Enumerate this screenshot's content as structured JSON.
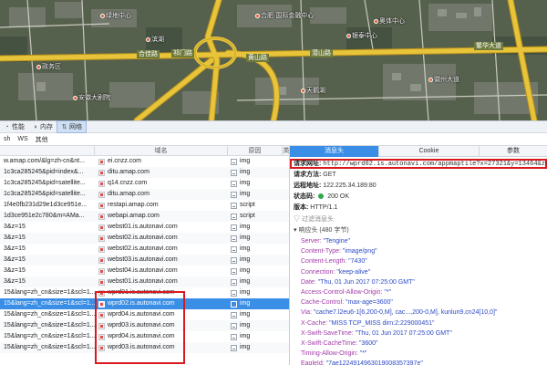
{
  "map": {
    "road_labels": [
      "合佳路",
      "祁门路",
      "黄山路",
      "潜山路",
      "繁华大道"
    ],
    "place_labels": [
      "绿地中心",
      "合肥·国际金融中心",
      "奥体中心",
      "政务区",
      "滨湖",
      "天鹅湖",
      "徽州大道",
      "安徽大剧院",
      "银泰中心"
    ],
    "colors": {
      "road": "#e7c43a",
      "road_edge": "#b8901c",
      "terrain": "#56614d",
      "water": "#3b4a55"
    }
  },
  "devtools": {
    "tabs": [
      {
        "icon": "gauge-icon",
        "label": "性能"
      },
      {
        "icon": "memory-icon",
        "label": "内存"
      },
      {
        "icon": "network-icon",
        "label": "网络"
      }
    ],
    "filters": [
      "sh",
      "WS",
      "其他"
    ]
  },
  "request_list": {
    "columns": [
      "",
      "域名",
      "原因",
      "类"
    ],
    "rows": [
      {
        "path": "w.amap.com/&lg=zh-cn&nt...",
        "domain": "ei.cnzz.com",
        "type": "img"
      },
      {
        "path": "1c3ca285245&pid=index&...",
        "domain": "ditu.amap.com",
        "type": "img"
      },
      {
        "path": "1c3ca285245&pid=satellite...",
        "domain": "q14.cnzz.com",
        "type": "img"
      },
      {
        "path": "1c3ca285245&pid=satellite...",
        "domain": "ditu.amap.com",
        "type": "img"
      },
      {
        "path": "1f4e0fb231d29e1d3ce951e...",
        "domain": "restapi.amap.com",
        "type": "script"
      },
      {
        "path": "1d3ce951e2c780&m=AMa...",
        "domain": "webapi.amap.com",
        "type": "script"
      },
      {
        "path": "3&z=15",
        "domain": "webst01.is.autonavi.com",
        "type": "img"
      },
      {
        "path": "3&z=15",
        "domain": "webst02.is.autonavi.com",
        "type": "img"
      },
      {
        "path": "3&z=15",
        "domain": "webst02.is.autonavi.com",
        "type": "img"
      },
      {
        "path": "3&z=15",
        "domain": "webst03.is.autonavi.com",
        "type": "img"
      },
      {
        "path": "3&z=15",
        "domain": "webst04.is.autonavi.com",
        "type": "img"
      },
      {
        "path": "3&z=15",
        "domain": "webst01.is.autonavi.com",
        "type": "img"
      },
      {
        "path": "15&lang=zh_cn&size=1&scl=1...",
        "domain": "wprd01.is.autonavi.com",
        "type": "img"
      },
      {
        "path": "15&lang=zh_cn&size=1&scl=1...",
        "domain": "wprd02.is.autonavi.com",
        "type": "img"
      },
      {
        "path": "15&lang=zh_cn&size=1&scl=1...",
        "domain": "wprd04.is.autonavi.com",
        "type": "img"
      },
      {
        "path": "15&lang=zh_cn&size=1&scl=1...",
        "domain": "wprd03.is.autonavi.com",
        "type": "img"
      },
      {
        "path": "15&lang=zh_cn&size=1&scl=1...",
        "domain": "wprd04.is.autonavi.com",
        "type": "img"
      },
      {
        "path": "15&lang=zh_cn&size=1&scl=1...",
        "domain": "wprd03.is.autonavi.com",
        "type": "img"
      }
    ],
    "selected_index": 13
  },
  "detail": {
    "tabs": [
      "消息头",
      "Cookie",
      "参数"
    ],
    "active_tab": 0,
    "request_url_label": "请求网址:",
    "request_url": "http://wprd02.is.autonavi.com/appmaptile?x=27321&y=13464&z=15&lang",
    "method_label": "请求方法:",
    "method": "GET",
    "remote_label": "远程地址:",
    "remote": "122.225.34.189:80",
    "status_label": "状态码:",
    "status": "200 OK",
    "version_label": "版本:",
    "version": "HTTP/1.1",
    "filter_placeholder": "过滤消息头",
    "response_section": "响应头 (480 字节)",
    "response_headers": [
      {
        "name": "Server:",
        "value": "\"Tengine\""
      },
      {
        "name": "Content-Type:",
        "value": "\"image/png\""
      },
      {
        "name": "Content-Length:",
        "value": "\"7430\""
      },
      {
        "name": "Connection:",
        "value": "\"keep-alive\""
      },
      {
        "name": "Date:",
        "value": "\"Thu, 01 Jun 2017 07:25:00 GMT\""
      },
      {
        "name": "Access-Control-Allow-Origin:",
        "value": "\"*\""
      },
      {
        "name": "Cache-Control:",
        "value": "\"max-age=3600\""
      },
      {
        "name": "Via:",
        "value": "\"cache7.l2eu6-1[6,200-0,M], cac...,200-0,M], kunlun9.cn24[10,0]\""
      },
      {
        "name": "X-Cache:",
        "value": "\"MISS TCP_MISS dirn:2:229000451\""
      },
      {
        "name": "X-Swift-SaveTime:",
        "value": "\"Thu, 01 Jun 2017 07:25:00 GMT\""
      },
      {
        "name": "X-Swift-CacheTime:",
        "value": "\"3600\""
      },
      {
        "name": "Timing-Allow-Origin:",
        "value": "\"*\""
      },
      {
        "name": "EagleId:",
        "value": "\"7ae1224914963019008357397e\""
      }
    ]
  }
}
